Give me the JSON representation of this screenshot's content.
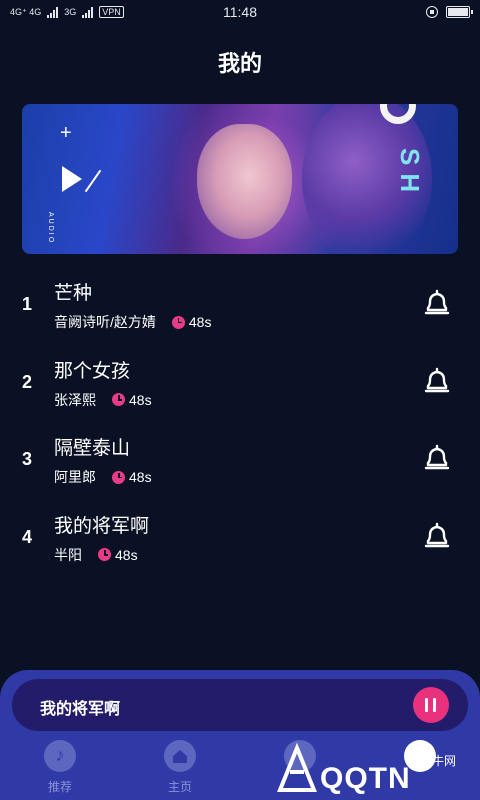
{
  "status_bar": {
    "network_1": "4G⁺ 4G",
    "network_2": "3G",
    "vpn": "VPN",
    "time": "11:48"
  },
  "page": {
    "title": "我的"
  },
  "banner": {
    "plus": "+",
    "audio_text": "AUDIO",
    "brand_text": "SH"
  },
  "songs": [
    {
      "index": "1",
      "title": "芒种",
      "artist": "音阙诗听/赵方婧",
      "duration": "48s"
    },
    {
      "index": "2",
      "title": "那个女孩",
      "artist": "张泽熙",
      "duration": "48s"
    },
    {
      "index": "3",
      "title": "隔壁泰山",
      "artist": "阿里郎",
      "duration": "48s"
    },
    {
      "index": "4",
      "title": "我的将军啊",
      "artist": "半阳",
      "duration": "48s"
    }
  ],
  "player": {
    "now_playing": "我的将军啊"
  },
  "tabs": [
    {
      "label": "推荐",
      "icon": "music-note-icon"
    },
    {
      "label": "主页",
      "icon": "home-icon"
    },
    {
      "label": "",
      "icon": "compass-icon"
    },
    {
      "label": "",
      "icon": "user-icon"
    }
  ],
  "watermark": {
    "text": "QQTN",
    "sub": "腾牛网"
  },
  "colors": {
    "background": "#0b1124",
    "accent": "#e8327d",
    "bottom_bar": "#2f3aa6",
    "mini_player": "#221c6b"
  }
}
